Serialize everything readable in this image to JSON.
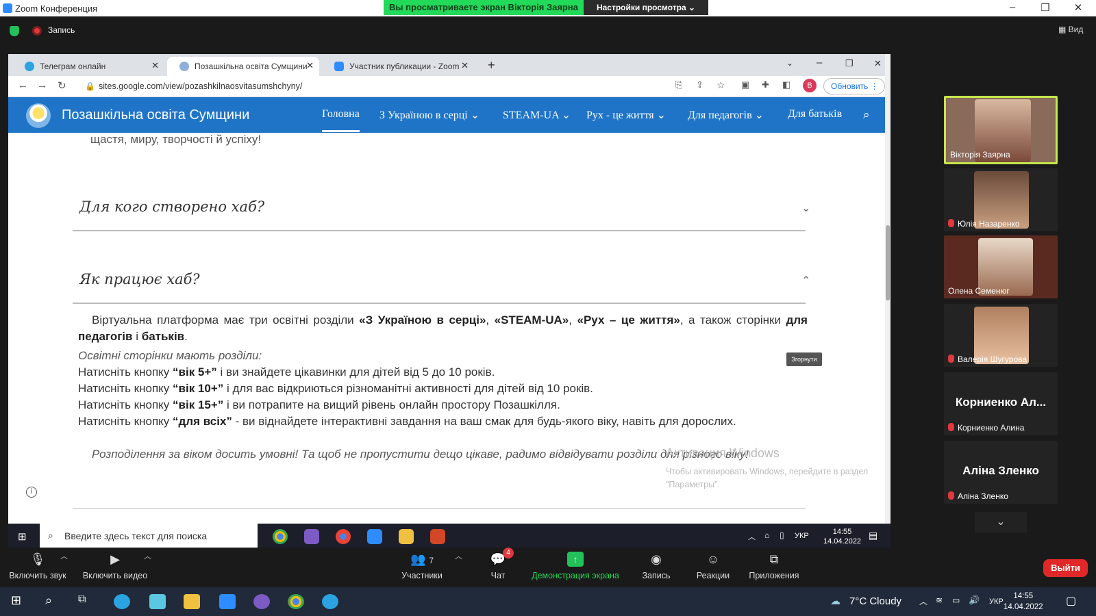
{
  "zoom": {
    "window_title": "Zoom Конференция",
    "viewing_banner": "Вы просматриваете экран Вікторія Заярна",
    "view_settings": "Настройки просмотра ⌄",
    "record_label": "Запись",
    "view_button": "Вид",
    "controls": {
      "audio": "Включить звук",
      "video": "Включить видео",
      "participants": "Участники",
      "participants_count": "7",
      "chat": "Чат",
      "chat_badge": "4",
      "share": "Демонстрация экрана",
      "record": "Запись",
      "reactions": "Реакции",
      "apps": "Приложения",
      "leave": "Выйти"
    },
    "participants": [
      {
        "name": "Вікторія Заярна",
        "active_speaker": true
      },
      {
        "name": "Юлія Назаренко",
        "muted": true
      },
      {
        "name": "Олена Семенюг"
      },
      {
        "name": "Валерія Шугурова",
        "muted": true
      },
      {
        "name": "Корниенко Алина",
        "display": "Корниенко Ал...",
        "muted": true
      },
      {
        "name": "Аліна Зленко",
        "display": "Аліна Зленко",
        "muted": true
      }
    ]
  },
  "browser": {
    "tabs": [
      {
        "label": "Телеграм онлайн",
        "icon_color": "#2aa3e0"
      },
      {
        "label": "Позашкільна освіта Сумщини",
        "icon_color": "#8fb0d6"
      },
      {
        "label": "Участник публикации - Zoom",
        "icon_color": "#2d8cff"
      }
    ],
    "url": "sites.google.com/view/pozashkilnaosvitasumshchyny/",
    "update_button": "Обновить",
    "profile_initial": "В"
  },
  "site": {
    "title": "Позашкільна освіта Сумщини",
    "nav": [
      "Головна",
      "З Україною в серці ⌄",
      "STEAM-UA ⌄",
      "Рух - це життя ⌄",
      "Для педагогів ⌄",
      "Для батьків"
    ],
    "prev_line": "щастя, миру, творчості й успіху!",
    "accordion_1_title": "Для кого створено хаб?",
    "accordion_2_title": "Як працює хаб?",
    "p1_a": "Віртуальна платформа має три освітні розділи ",
    "p1_b": "«З Україною в серці»",
    "p1_c": ", ",
    "p1_d": "«STEAM-UA»",
    "p1_e": ", ",
    "p1_f": "«Рух – це життя»",
    "p1_g": ", а також сторінки ",
    "p1_h": "для педагогів",
    "p1_i": " і ",
    "p1_j": "батьків",
    "p1_k": ".",
    "p2": "Освітні сторінки мають розділи:",
    "l1_pre": "Натисніть кнопку ",
    "l1_btn": "“вік 5+”",
    "l1_post": " і ви знайдете цікавинки для дітей від 5 до 10 років.",
    "l2_pre": "Натисніть кнопку ",
    "l2_btn": "“вік 10+”",
    "l2_post": " і для вас відкриються різноманітні активності для дітей від 10 років.",
    "l3_pre": "Натисніть кнопку ",
    "l3_btn": "“вік 15+”",
    "l3_post": " і ви потрапите на вищий рівень онлайн простору Позашкілля.",
    "l4_pre": "Натисніть кнопку ",
    "l4_btn": "“для всіх”",
    "l4_post": " - ви віднайдете інтерактивні завдання на ваш смак для будь-якого віку, навіть для дорослих.",
    "p_last": "Розподілення за віком досить умовні! Та щоб не пропустити дещо цікаве, радимо відвідувати розділи для різного віку!",
    "collapse_tooltip": "Згорнути",
    "activation_title": "Активация Windows",
    "activation_sub": "Чтобы активировать Windows, перейдите в раздел \"Параметры\"."
  },
  "inner_taskbar": {
    "search_placeholder": "Введите здесь текст для поиска",
    "lang": "УКР",
    "time": "14:55",
    "date": "14.04.2022"
  },
  "os_taskbar": {
    "weather": "7°C  Cloudy",
    "lang": "УКР",
    "time": "14:55",
    "date": "14.04.2022"
  }
}
